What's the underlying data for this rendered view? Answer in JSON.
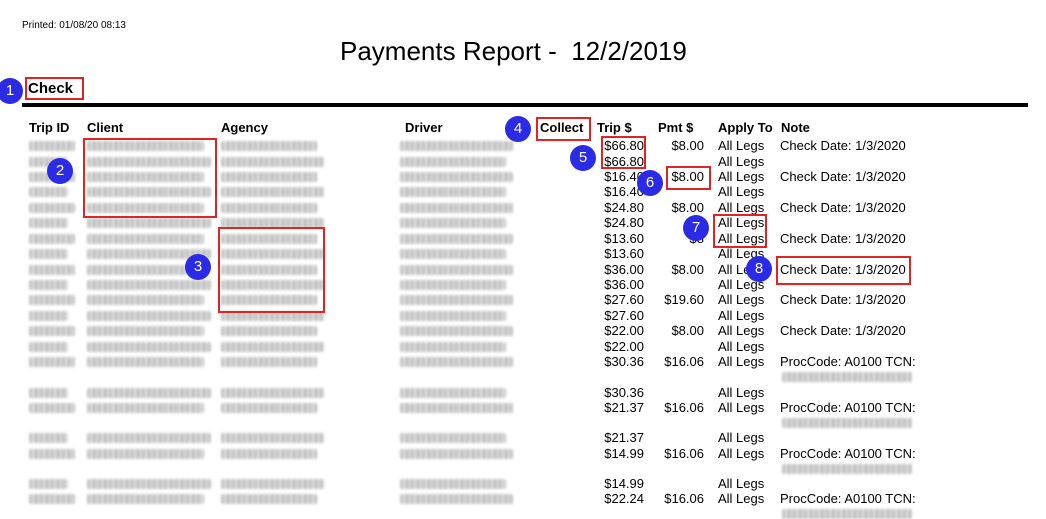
{
  "header": {
    "printed": "Printed: 01/08/20 08:13",
    "title": "Payments Report -  12/2/2019",
    "section": "Check"
  },
  "columns": {
    "trip_id": "Trip ID",
    "client": "Client",
    "agency": "Agency",
    "driver": "Driver",
    "collect": "Collect",
    "trip_amount": "Trip $",
    "pmt_amount": "Pmt $",
    "apply_to": "Apply To",
    "note": "Note"
  },
  "rows": [
    {
      "trip": "$66.80",
      "pmt": "$8.00",
      "apply": "All Legs",
      "note": "Check Date: 1/3/2020"
    },
    {
      "trip": "$66.80",
      "pmt": "",
      "apply": "All Legs",
      "note": ""
    },
    {
      "trip": "$16.40",
      "pmt": "$8.00",
      "apply": "All Legs",
      "note": "Check Date: 1/3/2020"
    },
    {
      "trip": "$16.40",
      "pmt": "",
      "apply": "All Legs",
      "note": ""
    },
    {
      "trip": "$24.80",
      "pmt": "$8.00",
      "apply": "All Legs",
      "note": "Check Date: 1/3/2020"
    },
    {
      "trip": "$24.80",
      "pmt": "",
      "apply": "All Legs",
      "note": ""
    },
    {
      "trip": "$13.60",
      "pmt": "$8",
      "apply": "All Legs",
      "note": "Check Date: 1/3/2020"
    },
    {
      "trip": "$13.60",
      "pmt": "",
      "apply": "All Legs",
      "note": ""
    },
    {
      "trip": "$36.00",
      "pmt": "$8.00",
      "apply": "All Le",
      "note": "Check Date: 1/3/2020"
    },
    {
      "trip": "$36.00",
      "pmt": "",
      "apply": "All Legs",
      "note": ""
    },
    {
      "trip": "$27.60",
      "pmt": "$19.60",
      "apply": "All Legs",
      "note": "Check Date: 1/3/2020"
    },
    {
      "trip": "$27.60",
      "pmt": "",
      "apply": "All Legs",
      "note": ""
    },
    {
      "trip": "$22.00",
      "pmt": "$8.00",
      "apply": "All Legs",
      "note": "Check Date: 1/3/2020"
    },
    {
      "trip": "$22.00",
      "pmt": "",
      "apply": "All Legs",
      "note": ""
    },
    {
      "trip": "$30.36",
      "pmt": "$16.06",
      "apply": "All Legs",
      "note": "ProcCode: A0100 TCN:"
    },
    {
      "trip": "$30.36",
      "pmt": "",
      "apply": "All Legs",
      "note": ""
    },
    {
      "trip": "$21.37",
      "pmt": "$16.06",
      "apply": "All Legs",
      "note": "ProcCode: A0100 TCN:"
    },
    {
      "trip": "$21.37",
      "pmt": "",
      "apply": "All Legs",
      "note": ""
    },
    {
      "trip": "$14.99",
      "pmt": "$16.06",
      "apply": "All Legs",
      "note": "ProcCode: A0100 TCN:"
    },
    {
      "trip": "$14.99",
      "pmt": "",
      "apply": "All Legs",
      "note": ""
    },
    {
      "trip": "$22.24",
      "pmt": "$16.06",
      "apply": "All Legs",
      "note": "ProcCode: A0100 TCN:"
    }
  ],
  "callouts": [
    "1",
    "2",
    "3",
    "4",
    "5",
    "6",
    "7",
    "8"
  ],
  "colors": {
    "highlight": "#e02424",
    "badge": "#2b2be6"
  }
}
